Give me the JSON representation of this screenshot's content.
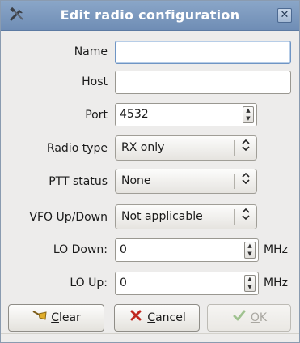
{
  "window": {
    "title": "Edit radio configuration",
    "title_icon": "tools-icon",
    "close_glyph": "✕"
  },
  "fields": {
    "name": {
      "label": "Name",
      "value": ""
    },
    "host": {
      "label": "Host",
      "value": ""
    },
    "port": {
      "label": "Port",
      "value": "4532"
    },
    "radio_type": {
      "label": "Radio type",
      "value": "RX only"
    },
    "ptt_status": {
      "label": "PTT status",
      "value": "None"
    },
    "vfo_updown": {
      "label": "VFO Up/Down",
      "value": "Not applicable"
    },
    "lo_down": {
      "label": "LO Down:",
      "value": "0",
      "unit": "MHz"
    },
    "lo_up": {
      "label": "LO Up:",
      "value": "0",
      "unit": "MHz"
    }
  },
  "buttons": {
    "clear": {
      "mnemonic": "C",
      "rest": "lear",
      "icon": "broom-icon"
    },
    "cancel": {
      "mnemonic": "C",
      "rest": "ancel",
      "icon": "cancel-x-icon"
    },
    "ok": {
      "mnemonic": "O",
      "rest": "K",
      "icon": "checkmark-icon",
      "enabled": false
    }
  },
  "colors": {
    "titlebar": "#7c99c0",
    "cancel_icon": "#c0281f",
    "clear_icon": "#d8a21e"
  }
}
